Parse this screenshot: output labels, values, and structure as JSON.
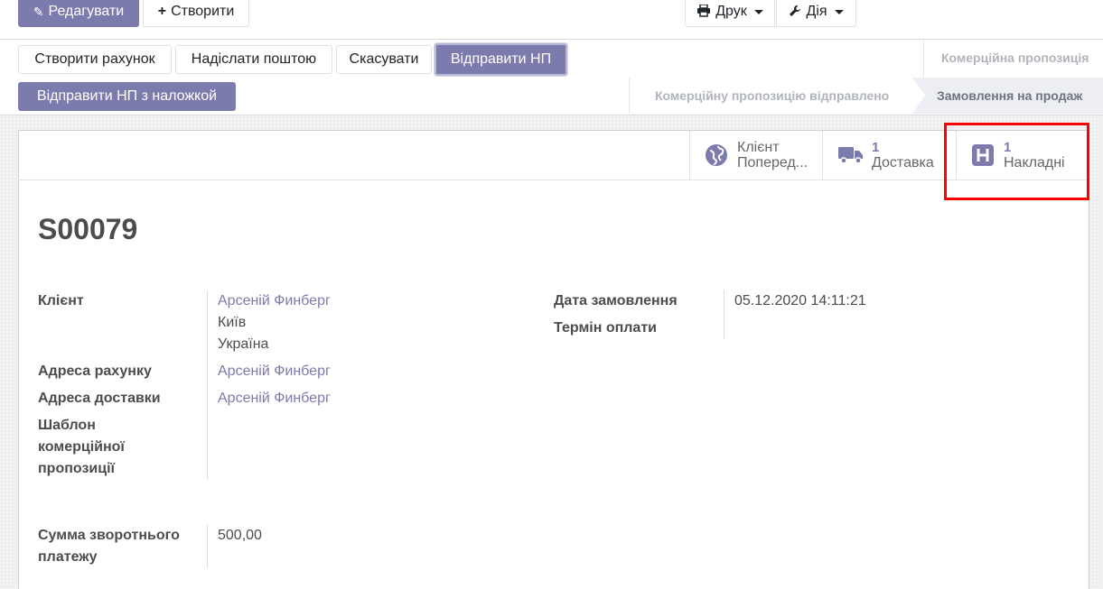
{
  "toolbar": {
    "edit_label": "Редагувати",
    "create_label": "Створити",
    "print_label": "Друк",
    "action_label": "Дія"
  },
  "header_buttons": {
    "create_invoice": "Створити рахунок",
    "send_email": "Надіслати поштою",
    "cancel": "Скасувати",
    "send_np": "Відправити НП",
    "send_np_cod": "Відправити НП з наложкой"
  },
  "statusbar": {
    "stage_quotation": "Комерційна пропозиція",
    "stage_sent": "Комерційну пропозицію відправлено",
    "stage_sale": "Замовлення на продаж"
  },
  "smart_buttons": {
    "customer_line1": "Клієнт",
    "customer_line2": "Поперед...",
    "delivery_count": "1",
    "delivery_label": "Доставка",
    "waybill_count": "1",
    "waybill_label": "Накладні"
  },
  "order": {
    "name": "S00079",
    "customer_label": "Клієнт",
    "customer_name": "Арсеній Финберг",
    "customer_city": "Київ",
    "customer_country": "Україна",
    "invoice_address_label": "Адреса рахунку",
    "invoice_address": "Арсеній Финберг",
    "delivery_address_label": "Адреса доставки",
    "delivery_address": "Арсеній Финберг",
    "template_label_1": "Шаблон",
    "template_label_2": "комерційної",
    "template_label_3": "пропозиції",
    "order_date_label": "Дата замовлення",
    "order_date": "05.12.2020 14:11:21",
    "payment_terms_label": "Термін оплати",
    "cod_label_1": "Сумма зворотнього",
    "cod_label_2": "платежу",
    "cod_value": "500,00"
  },
  "colors": {
    "primary": "#7c7bad",
    "highlight": "#ff0000"
  }
}
